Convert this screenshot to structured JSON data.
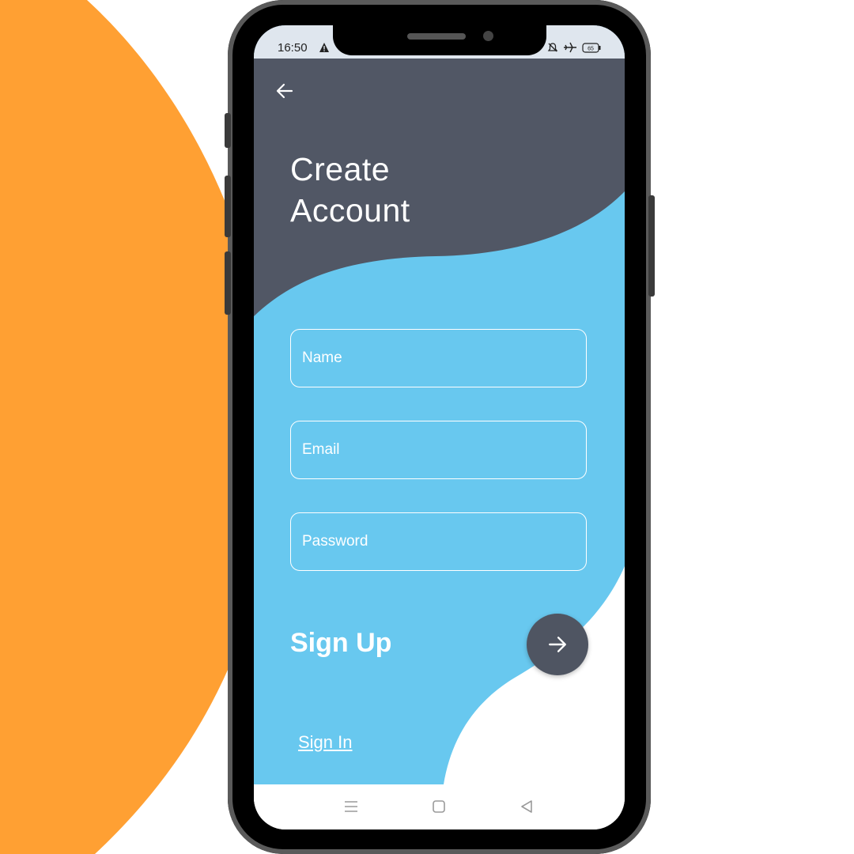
{
  "colors": {
    "orange_blob": "#ffa033",
    "header_dark": "#515765",
    "body_blue": "#68c8ef",
    "fab": "#4f5562"
  },
  "status_bar": {
    "time": "16:50",
    "battery": "65",
    "icons": [
      "warning-icon",
      "dnd-icon",
      "airplane-icon",
      "battery-icon"
    ]
  },
  "header": {
    "back_icon": "arrow-left-icon",
    "title_line1": "Create",
    "title_line2": "Account"
  },
  "form": {
    "name_placeholder": "Name",
    "email_placeholder": "Email",
    "password_placeholder": "Password"
  },
  "actions": {
    "signup_label": "Sign Up",
    "signup_icon": "arrow-right-icon",
    "signin_link": "Sign In"
  },
  "nav_bar": {
    "icons": [
      "menu-icon",
      "home-icon",
      "back-triangle-icon"
    ]
  }
}
